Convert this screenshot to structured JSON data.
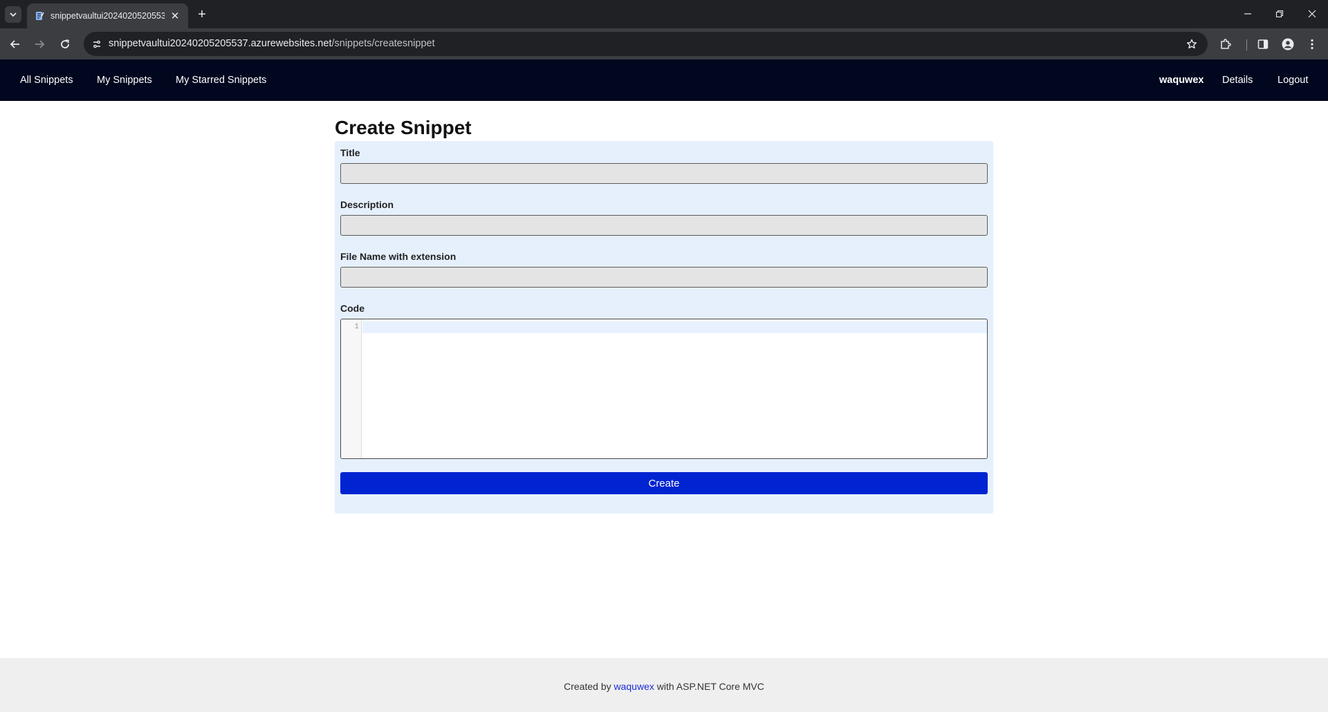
{
  "browser": {
    "tab_title": "snippetvaultui20240205205537",
    "url_host": "snippetvaultui20240205205537.azurewebsites.net",
    "url_path": "/snippets/createsnippet"
  },
  "nav": {
    "links": [
      "All Snippets",
      "My Snippets",
      "My Starred Snippets"
    ],
    "username": "waquwex",
    "details": "Details",
    "logout": "Logout"
  },
  "page": {
    "title": "Create Snippet"
  },
  "form": {
    "title_label": "Title",
    "title_value": "",
    "description_label": "Description",
    "description_value": "",
    "filename_label": "File Name with extension",
    "filename_value": "",
    "code_label": "Code",
    "line_number": "1",
    "create_button": "Create"
  },
  "footer": {
    "prefix": "Created by ",
    "author": "waquwex",
    "suffix": " with ASP.NET Core MVC"
  },
  "colors": {
    "navbar": "#020720",
    "form_background": "#e6f0fd",
    "button": "#0024d1",
    "footer_link": "#1a2bd6"
  }
}
